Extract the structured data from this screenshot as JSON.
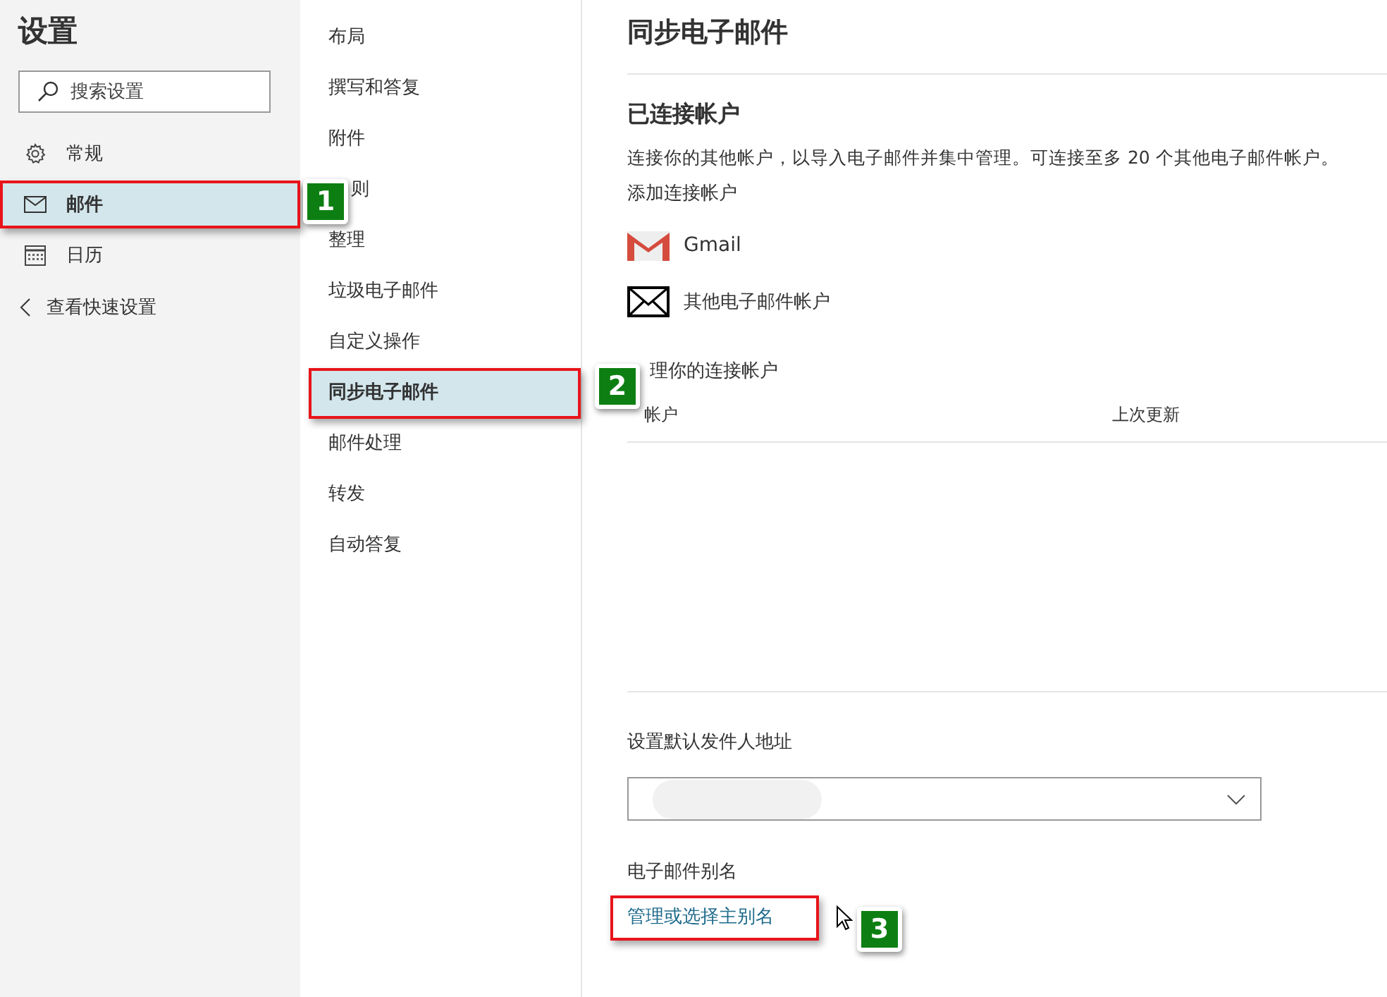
{
  "sidebar": {
    "title": "设置",
    "search": {
      "placeholder": "搜索设置"
    },
    "items": [
      {
        "kind": "gear",
        "label": "常规",
        "selected": false,
        "annotated": false
      },
      {
        "kind": "mail",
        "label": "邮件",
        "selected": true,
        "annotated": true
      },
      {
        "kind": "calendar",
        "label": "日历",
        "selected": false,
        "annotated": false
      }
    ],
    "back_link": "查看快速设置"
  },
  "subnav": {
    "items": [
      {
        "label": "布局",
        "selected": false,
        "annotated": false
      },
      {
        "label": "撰写和答复",
        "selected": false,
        "annotated": false
      },
      {
        "label": "附件",
        "selected": false,
        "annotated": false
      },
      {
        "label": "则",
        "selected": false,
        "annotated": false,
        "partly_covered": true
      },
      {
        "label": "整理",
        "selected": false,
        "annotated": false
      },
      {
        "label": "垃圾电子邮件",
        "selected": false,
        "annotated": false
      },
      {
        "label": "自定义操作",
        "selected": false,
        "annotated": false
      },
      {
        "label": "同步电子邮件",
        "selected": true,
        "annotated": true
      },
      {
        "label": "邮件处理",
        "selected": false,
        "annotated": false
      },
      {
        "label": "转发",
        "selected": false,
        "annotated": false
      },
      {
        "label": "自动答复",
        "selected": false,
        "annotated": false
      }
    ]
  },
  "content": {
    "title": "同步电子邮件",
    "connected": {
      "heading": "已连接帐户",
      "description": "连接你的其他帐户，以导入电子邮件并集中管理。可连接至多 20 个其他电子邮件帐户。",
      "add_label": "添加连接帐户",
      "providers": [
        {
          "kind": "gmail",
          "label": "Gmail"
        },
        {
          "kind": "envelope",
          "label": "其他电子邮件帐户"
        }
      ],
      "manage_label": "理你的连接帐户",
      "table": {
        "columns": [
          "帐户",
          "上次更新"
        ]
      }
    },
    "default_from": {
      "label": "设置默认发件人地址"
    },
    "alias": {
      "label": "电子邮件别名",
      "link": "管理或选择主别名",
      "annotated": true
    }
  },
  "annotations": [
    {
      "number": "1"
    },
    {
      "number": "2"
    },
    {
      "number": "3"
    }
  ]
}
